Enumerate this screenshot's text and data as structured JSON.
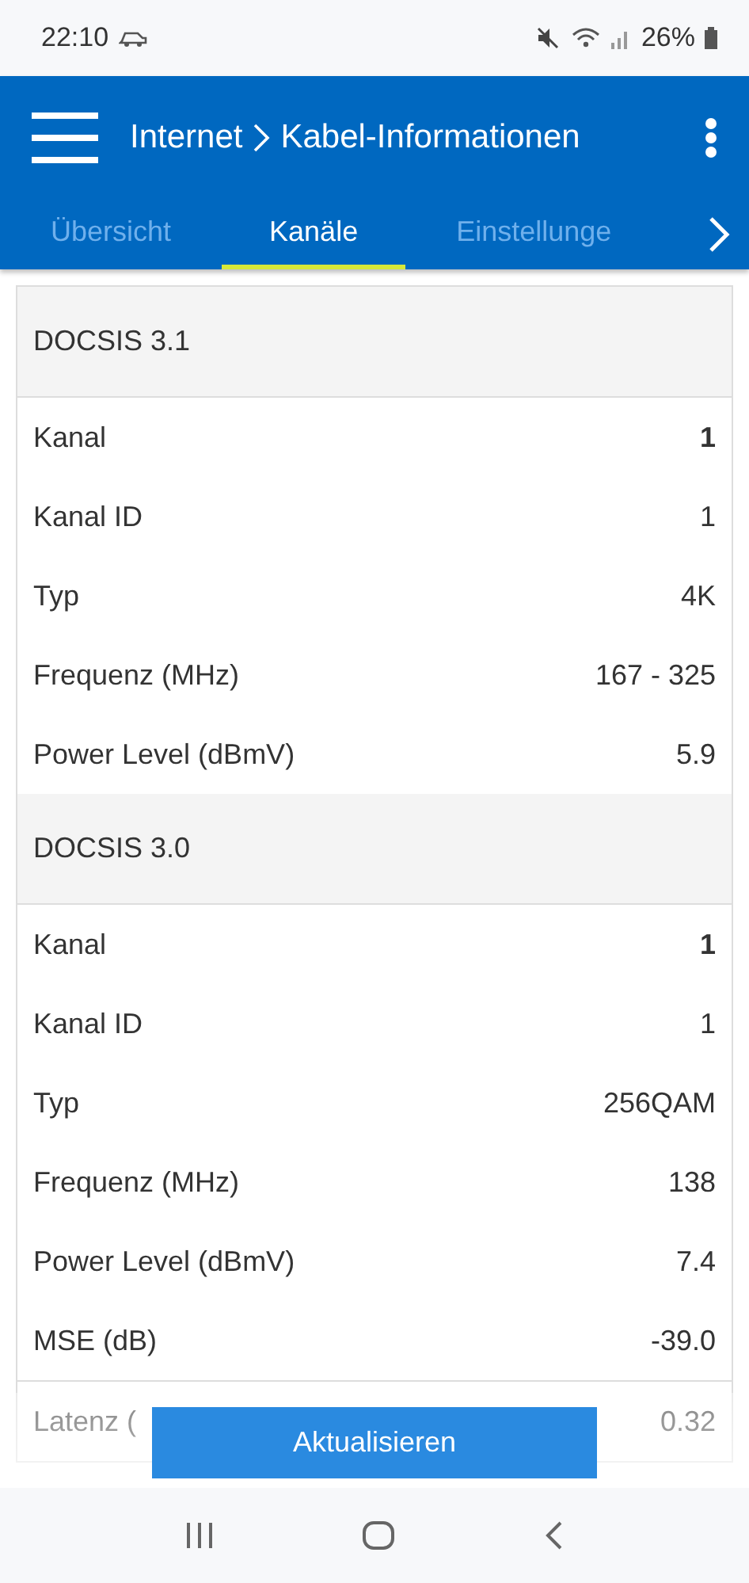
{
  "status_bar": {
    "time": "22:10",
    "battery": "26%"
  },
  "header": {
    "title_parent": "Internet",
    "title": "Kabel-Informationen"
  },
  "tabs": [
    {
      "label": "Übersicht",
      "selected": false
    },
    {
      "label": "Kanäle",
      "selected": true
    },
    {
      "label": "Einstellunge",
      "selected": false
    }
  ],
  "sections": [
    {
      "title": "DOCSIS 3.1",
      "rows": [
        {
          "label": "Kanal",
          "value": "1",
          "bold": true
        },
        {
          "label": "Kanal ID",
          "value": "1",
          "bold": false
        },
        {
          "label": "Typ",
          "value": "4K",
          "bold": false
        },
        {
          "label": "Frequenz (MHz)",
          "value": "167 - 325",
          "bold": false
        },
        {
          "label": "Power Level (dBmV)",
          "value": "5.9",
          "bold": false
        }
      ]
    },
    {
      "title": "DOCSIS 3.0",
      "rows": [
        {
          "label": "Kanal",
          "value": "1",
          "bold": true
        },
        {
          "label": "Kanal ID",
          "value": "1",
          "bold": false
        },
        {
          "label": "Typ",
          "value": "256QAM",
          "bold": false
        },
        {
          "label": "Frequenz (MHz)",
          "value": "138",
          "bold": false
        },
        {
          "label": "Power Level (dBmV)",
          "value": "7.4",
          "bold": false
        },
        {
          "label": "MSE (dB)",
          "value": "-39.0",
          "bold": false
        },
        {
          "label": "Latenz (",
          "value": "0.32",
          "bold": false
        }
      ]
    }
  ],
  "refresh_button": "Aktualisieren"
}
